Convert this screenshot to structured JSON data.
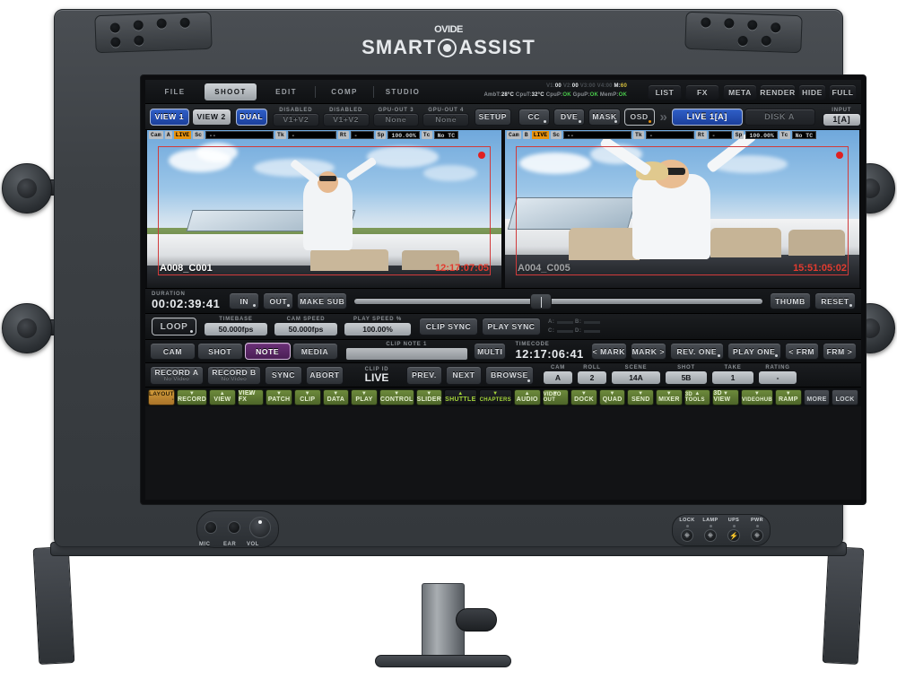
{
  "device": {
    "brand": "OVIDE",
    "model": "SMART ASSIST",
    "logo_icon": "target-ring-icon"
  },
  "menu_bar": {
    "items": [
      {
        "label": "FILE",
        "selected": false
      },
      {
        "label": "SHOOT",
        "selected": true
      },
      {
        "label": "EDIT",
        "selected": false
      },
      {
        "label": "COMP",
        "selected": false
      },
      {
        "label": "STUDIO",
        "selected": false
      }
    ],
    "right_items": [
      {
        "label": "LIST"
      },
      {
        "label": "FX"
      },
      {
        "label": "META"
      }
    ],
    "far_right_items": [
      {
        "label": "RENDER"
      },
      {
        "label": "HIDE"
      },
      {
        "label": "FULL"
      }
    ]
  },
  "status": {
    "line1_prefix": "V1:",
    "v1": "00",
    "v2_label": "V2:",
    "v2": "00",
    "v3_label": "V3:",
    "v3": "00",
    "v4_label": "V4:",
    "v4": "00",
    "m_label": "M:",
    "m": "60",
    "amb_label": "AmbT:",
    "amb": "28°C",
    "cput_label": "CpuT:",
    "cput": "32°C",
    "cpup_label": "CpuP:",
    "cpup": "OK",
    "gpup_label": "GpuP:",
    "gpup": "OK",
    "memp_label": "MemP:",
    "memp": "OK"
  },
  "view_row": {
    "view1": "VIEW 1",
    "view2": "VIEW 2",
    "dual": "DUAL",
    "out_slots": [
      {
        "caption": "DISABLED",
        "value": "V1+V2"
      },
      {
        "caption": "DISABLED",
        "value": "V1+V2"
      },
      {
        "caption": "GPU-OUT 3",
        "value": "None"
      },
      {
        "caption": "GPU-OUT 4",
        "value": "None"
      }
    ],
    "setup": "SETUP",
    "cc": "CC",
    "dve": "DVE",
    "mask": "MASK",
    "osd": "OSD",
    "more_icon": "double-chevron-right-icon",
    "live": "LIVE 1[A]",
    "disk": "DISK A",
    "input_caption": "INPUT",
    "input_value": "1[A]"
  },
  "viewers": [
    {
      "cam_tag": "Cam",
      "cam_id": "A",
      "live": "LIVE",
      "sc_tag": "Sc",
      "sc_value": "--",
      "tk_tag": "Tk",
      "tk_value": "-",
      "rt_tag": "Rt",
      "rt_value": "-",
      "sp_tag": "Sp",
      "sp_value": "100.00%",
      "tc_tag": "Tc",
      "tc_value": "No TC",
      "clip_name": "A008_C001",
      "timecode": "12:17:07:05"
    },
    {
      "cam_tag": "Cam",
      "cam_id": "B",
      "live": "LIVE",
      "sc_tag": "Sc",
      "sc_value": "--",
      "tk_tag": "Tk",
      "tk_value": "-",
      "rt_tag": "Rt",
      "rt_value": "-",
      "sp_tag": "Sp",
      "sp_value": "100.00%",
      "tc_tag": "Tc",
      "tc_value": "No TC",
      "clip_name": "A004_C005",
      "timecode": "15:51:05:02"
    }
  ],
  "transport": {
    "duration_caption": "DURATION",
    "duration_value": "00:02:39:41",
    "in": "IN",
    "out": "OUT",
    "make_sub": "MAKE SUB",
    "thumb": "THUMB",
    "reset": "RESET",
    "scrub_position_pct": 43
  },
  "loop_row": {
    "loop": "LOOP",
    "timebase_caption": "TIMEBASE",
    "timebase_value": "50.000fps",
    "cam_speed_caption": "CAM SPEED",
    "cam_speed_value": "50.000fps",
    "play_speed_caption": "PLAY SPEED %",
    "play_speed_value": "100.00%",
    "clip_sync": "CLIP SYNC",
    "play_sync": "PLAY SYNC",
    "meter_labels": [
      "A:",
      "B:",
      "C:",
      "D:"
    ]
  },
  "note_row": {
    "tabs": [
      {
        "label": "CAM",
        "selected": false
      },
      {
        "label": "SHOT",
        "selected": false
      },
      {
        "label": "NOTE",
        "selected": true
      },
      {
        "label": "MEDIA",
        "selected": false
      }
    ],
    "note_caption": "CLIP NOTE 1",
    "note_value": "",
    "multi": "MULTI",
    "timecode_caption": "TIMECODE",
    "timecode_value": "12:17:06:41",
    "mark_prev": "< MARK",
    "mark_next": "MARK >",
    "rev_one": "REV. ONE",
    "play_one": "PLAY ONE",
    "frm_prev": "< FRM",
    "frm_next": "FRM >"
  },
  "record_row": {
    "record_a": {
      "label": "RECORD A",
      "sub": "No Video"
    },
    "record_b": {
      "label": "RECORD B",
      "sub": "No Video"
    },
    "sync": "SYNC",
    "abort": "ABORT",
    "clip_id_caption": "CLIP ID",
    "clip_id_value": "LIVE",
    "prev": "PREV.",
    "next": "NEXT",
    "browse": "BROWSE",
    "meta_fields": [
      {
        "caption": "CAM",
        "value": "A"
      },
      {
        "caption": "ROLL",
        "value": "2"
      },
      {
        "caption": "SCENE",
        "value": "14A"
      },
      {
        "caption": "SHOT",
        "value": "5B"
      },
      {
        "caption": "TAKE",
        "value": "1"
      },
      {
        "caption": "RATING",
        "value": "-"
      }
    ]
  },
  "function_strip": [
    {
      "label": "LAYOUT",
      "arrow": "-",
      "style": "amber"
    },
    {
      "label": "RECORD",
      "arrow": "▼",
      "style": "green"
    },
    {
      "label": "VIEW",
      "arrow": "▲",
      "style": "green"
    },
    {
      "label": "VIEW FX",
      "arrow": "▲",
      "style": "green"
    },
    {
      "label": "PATCH",
      "arrow": "▼",
      "style": "green"
    },
    {
      "label": "CLIP",
      "arrow": "▼",
      "style": "green"
    },
    {
      "label": "DATA",
      "arrow": "▼",
      "style": "green"
    },
    {
      "label": "PLAY",
      "arrow": "▼",
      "style": "green"
    },
    {
      "label": "CONTROL",
      "arrow": "▼",
      "style": "green"
    },
    {
      "label": "SLIDER",
      "arrow": "▼",
      "style": "green"
    },
    {
      "label": "SHUTTLE",
      "arrow": "▲",
      "style": "black"
    },
    {
      "label": "CHAPTERS",
      "arrow": "▼",
      "style": "black"
    },
    {
      "label": "AUDIO",
      "arrow": "▲",
      "style": "green"
    },
    {
      "label": "VIDEO OUT",
      "arrow": "▼",
      "style": "green"
    },
    {
      "label": "DOCK",
      "arrow": "▼",
      "style": "green"
    },
    {
      "label": "QUAD",
      "arrow": "▼",
      "style": "green"
    },
    {
      "label": "SEND",
      "arrow": "▼",
      "style": "green"
    },
    {
      "label": "MIXER",
      "arrow": "▼",
      "style": "green"
    },
    {
      "label": "3D TOOLS",
      "arrow": "▲",
      "style": "green"
    },
    {
      "label": "3D VIEW",
      "arrow": "▼",
      "style": "green"
    },
    {
      "label": "VIDEOHUB",
      "arrow": "▼",
      "style": "green"
    },
    {
      "label": "RAMP",
      "arrow": "▼",
      "style": "green"
    },
    {
      "label": "MORE",
      "arrow": "",
      "style": "grey"
    },
    {
      "label": "LOCK",
      "arrow": "",
      "style": "grey"
    }
  ],
  "front_panel": {
    "jacks": [
      {
        "label": "MIC",
        "icon": "audio-jack-icon"
      },
      {
        "label": "EAR",
        "icon": "audio-jack-icon"
      },
      {
        "label": "VOL",
        "icon": "rotary-knob-icon"
      }
    ],
    "indicators": [
      {
        "label": "LOCK",
        "icon": "power-button-icon"
      },
      {
        "label": "LAMP",
        "icon": "power-button-icon"
      },
      {
        "label": "UPS",
        "icon": "lightning-bolt-icon"
      },
      {
        "label": "PWR",
        "icon": "power-button-icon"
      }
    ]
  }
}
